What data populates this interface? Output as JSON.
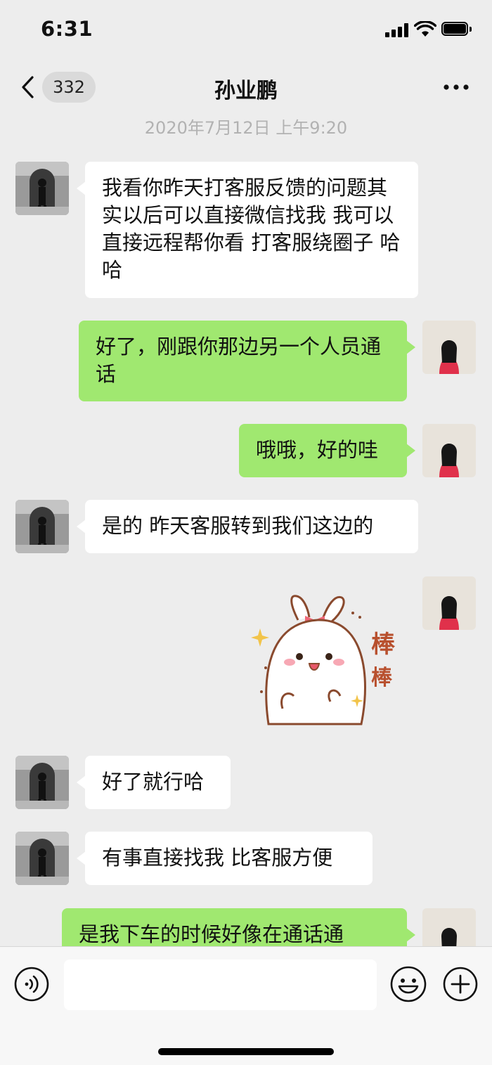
{
  "status_bar": {
    "time": "6:31"
  },
  "header": {
    "unread_count": "332",
    "title": "孙业鹏"
  },
  "timestamp": "2020年7月12日 上午9:20",
  "messages": [
    {
      "side": "left",
      "text": "我看你昨天打客服反馈的问题其实以后可以直接微信找我 我可以直接远程帮你看 打客服绕圈子 哈哈"
    },
    {
      "side": "right",
      "text": "好了，刚跟你那边另一个人员通话"
    },
    {
      "side": "right",
      "text": "哦哦，好的哇"
    },
    {
      "side": "left",
      "text": "是的 昨天客服转到我们这边的"
    },
    {
      "side": "right",
      "type": "sticker",
      "text": "棒棒"
    },
    {
      "side": "left",
      "text": "好了就行哈"
    },
    {
      "side": "left",
      "text": "有事直接找我 比客服方便"
    },
    {
      "side": "right",
      "text": "是我下车的时候好像在通话通"
    }
  ],
  "input_bar": {
    "value": "",
    "placeholder": ""
  },
  "icons": {
    "back": "chevron-left-icon",
    "more": "more-dots-icon",
    "voice": "voice-icon",
    "emoji": "emoji-icon",
    "plus": "plus-icon"
  },
  "colors": {
    "background": "#ededed",
    "incoming_bubble": "#ffffff",
    "outgoing_bubble": "#a0e870",
    "timestamp": "#b2b2b2"
  }
}
